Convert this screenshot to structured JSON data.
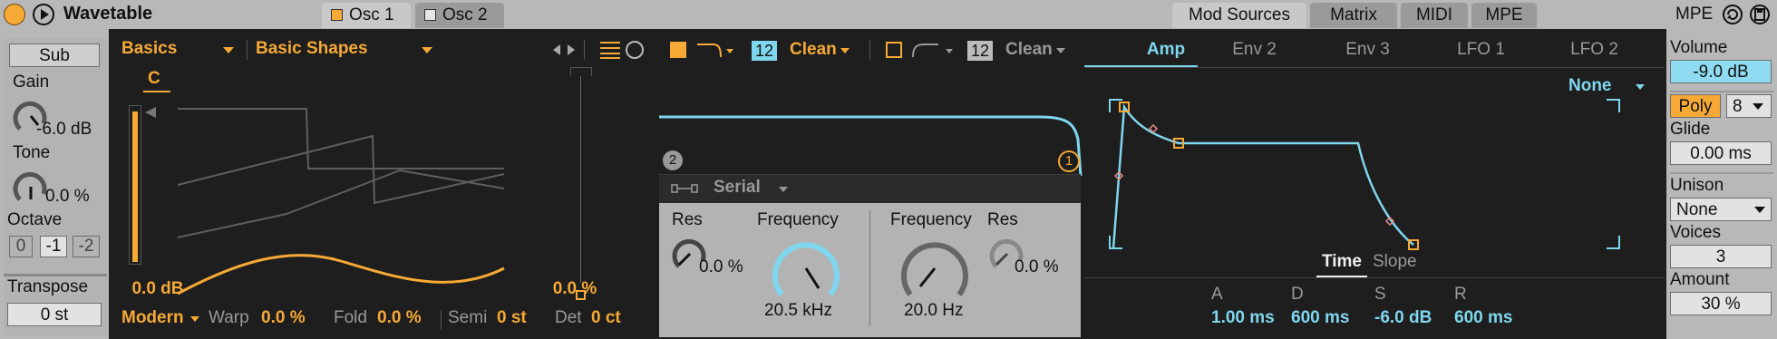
{
  "header": {
    "device_title": "Wavetable",
    "osc_tabs": [
      "Osc 1",
      "Osc 2"
    ],
    "mod_tabs": [
      "Mod Sources",
      "Matrix",
      "MIDI",
      "MPE"
    ],
    "mpe_label": "MPE"
  },
  "sub": {
    "button_label": "Sub",
    "gain_label": "Gain",
    "gain_value": "-6.0 dB",
    "tone_label": "Tone",
    "tone_value": "0.0 %",
    "octave_label": "Octave",
    "octave_options": [
      "0",
      "-1",
      "-2"
    ],
    "transpose_label": "Transpose",
    "transpose_value": "0 st"
  },
  "osc": {
    "category": "Basics",
    "wavetable": "Basic Shapes",
    "pitch_note": "C",
    "gain_value": "0.0 dB",
    "position_value": "0.0 %",
    "effect_mode": "Modern",
    "warp_label": "Warp",
    "warp_value": "0.0 %",
    "fold_label": "Fold",
    "fold_value": "0.0 %",
    "semi_label": "Semi",
    "semi_value": "0 st",
    "det_label": "Det",
    "det_value": "0 ct"
  },
  "filter": {
    "f1_slope": "12",
    "f1_circuit": "Clean",
    "f2_slope": "12",
    "f2_circuit": "Clean",
    "marker_2": "2",
    "marker_1": "1",
    "routing": "Serial",
    "res_label": "Res",
    "res_value": "0.0 %",
    "freq_label": "Frequency",
    "freq_value": "20.5 kHz",
    "f2_freq_label": "Frequency",
    "f2_freq_value": "20.0 Hz",
    "f2_res_label": "Res",
    "f2_res_value": "0.0 %"
  },
  "mod": {
    "tabs": [
      "Amp",
      "Env 2",
      "Env 3",
      "LFO 1",
      "LFO 2"
    ],
    "active_tab": "Amp",
    "dest": "None",
    "time_label": "Time",
    "slope_label": "Slope",
    "adsr_labels": [
      "A",
      "D",
      "S",
      "R"
    ],
    "adsr_values": [
      "1.00 ms",
      "600 ms",
      "-6.0 dB",
      "600 ms"
    ]
  },
  "global": {
    "volume_label": "Volume",
    "volume_value": "-9.0 dB",
    "poly_label": "Poly",
    "voices_count": "8",
    "glide_label": "Glide",
    "glide_value": "0.00 ms",
    "unison_label": "Unison",
    "unison_mode": "None",
    "voices_label": "Voices",
    "voices_value": "3",
    "amount_label": "Amount",
    "amount_value": "30 %"
  },
  "colors": {
    "accent_orange": "#f6a935",
    "accent_cyan": "#7fd6ef",
    "panel_gray": "#b3b3b3",
    "panel_dark": "#1e1e1e"
  }
}
